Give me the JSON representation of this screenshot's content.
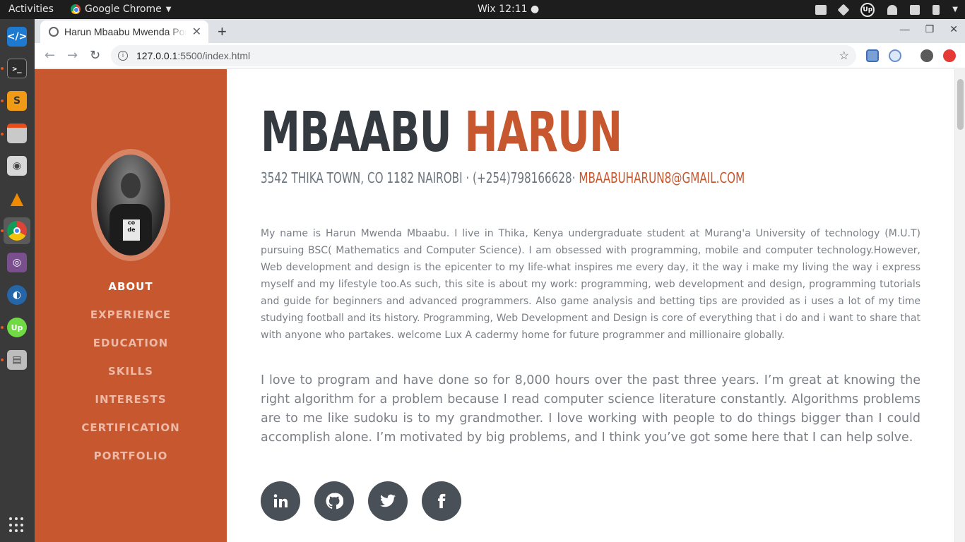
{
  "system_bar": {
    "activities": "Activities",
    "app_name": "Google Chrome",
    "clock": "Wix 12:11 ●",
    "upwork_badge": "Up"
  },
  "dock": {
    "apps": [
      "vscode-icon",
      "terminal-icon",
      "sublime-text-icon",
      "file-manager-icon",
      "camera-icon",
      "vlc-icon",
      "chrome-icon",
      "screenshot-icon",
      "browser-globe-icon",
      "upwork-icon",
      "printer-icon"
    ],
    "upwork_label": "Up"
  },
  "browser": {
    "tab_title": "Harun Mbaabu Mwenda Portfolio",
    "url_host": "127.0.0.1",
    "url_path": ":5500/index.html",
    "new_tab": "+",
    "tab_close": "✕"
  },
  "sidebar": {
    "nav": [
      {
        "label": "ABOUT",
        "active": true
      },
      {
        "label": "EXPERIENCE",
        "active": false
      },
      {
        "label": "EDUCATION",
        "active": false
      },
      {
        "label": "SKILLS",
        "active": false
      },
      {
        "label": "INTERESTS",
        "active": false
      },
      {
        "label": "CERTIFICATION",
        "active": false
      },
      {
        "label": "PORTFOLIO",
        "active": false
      }
    ],
    "photo_print": "co de"
  },
  "about": {
    "first_name": "MBAABU",
    "last_name": "HARUN",
    "address": "3542 Thika Town, CO 1182 Nairobi · (+254)798166628· ",
    "email": "mbaabuharun8@gmail.com",
    "bio": "My name is Harun Mwenda Mbaabu. I live in Thika, Kenya undergraduate student at Murang'a University of technology (M.U.T) pursuing BSC( Mathematics and Computer Science). I am obsessed with programming, mobile and computer technology.However, Web development and design is the epicenter to my life-what inspires me every day, it the way i make my living the way i express myself and my lifestyle too.As such, this site is about my work: programming, web development and design, programming tutorials and guide for beginners and advanced programmers. Also game analysis and betting tips are provided as i uses a lot of my time studying football and its history. Programming, Web Development and Design is core of everything that i do and i want to share that with anyone who partakes. welcome Lux A cadermy home for future programmer and millionaire globally.",
    "lead": "I love to program and have done so for 8,000 hours over the past three years. I’m great at knowing the right algorithm for a problem because I read computer science literature constantly. Algorithms problems are to me like sudoku is to my grandmother. I love working with people to do things bigger than I could accomplish alone. I’m motivated by big problems, and I think you’ve got some here that I can help solve.",
    "social": [
      "linkedin-icon",
      "github-icon",
      "twitter-icon",
      "facebook-icon"
    ]
  },
  "colors": {
    "accent": "#c6572e",
    "heading": "#343a40",
    "muted": "#6c757d",
    "social_bg": "#495057"
  }
}
